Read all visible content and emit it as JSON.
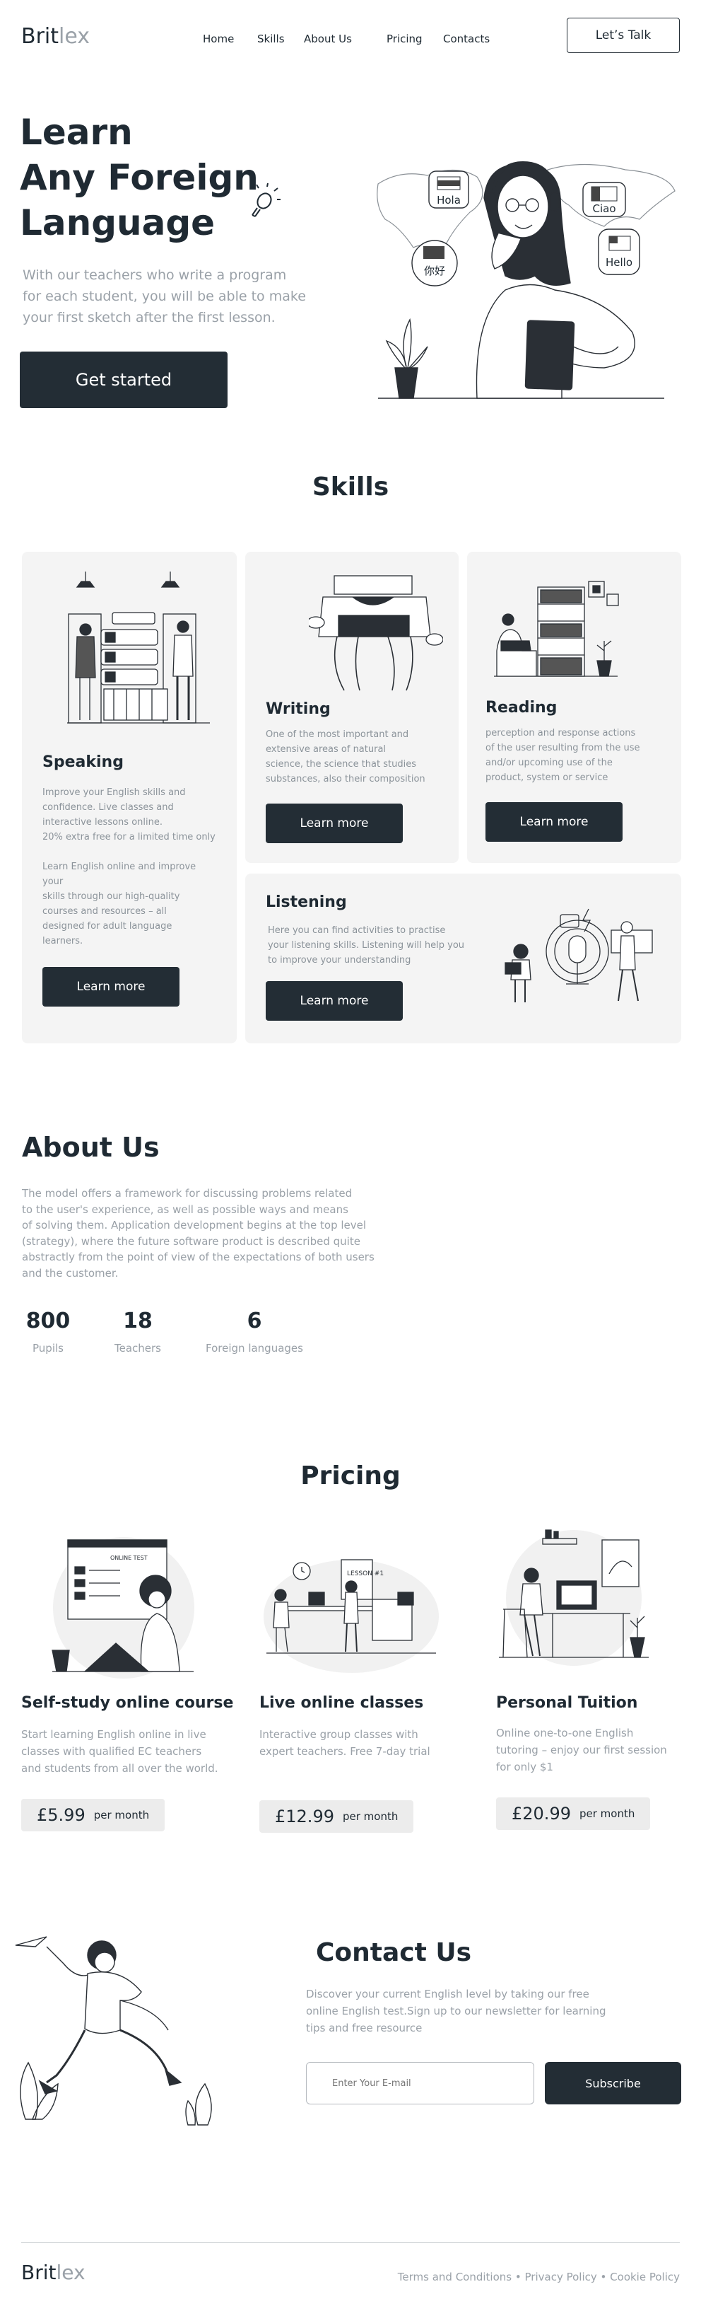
{
  "header": {
    "logo_bold": "Brit",
    "logo_light": "lex",
    "nav": [
      {
        "label": "Home"
      },
      {
        "label": "Skills"
      },
      {
        "label": "About Us"
      },
      {
        "label": "Pricing"
      },
      {
        "label": "Contacts"
      }
    ],
    "cta_label": "Let’s Talk"
  },
  "hero": {
    "title_line1": "Learn",
    "title_line2": "Any Foreign",
    "title_line3": "Language",
    "subtitle": "With our teachers who write a program\nfor each student, you will be able to make\nyour first sketch after the first lesson.",
    "button_label": "Get started",
    "bubbles": {
      "hola": "Hola",
      "ciao": "Ciao",
      "nihao": "你好",
      "hello": "Hello"
    }
  },
  "skills": {
    "title": "Skills",
    "speaking": {
      "title": "Speaking",
      "text": "Improve your English skills and\nconfidence. Live classes and\ninteractive lessons online.\n20% extra free for a limited time only\n\nLearn English online and improve\nyour\nskills through our high-quality\ncourses and resources – all\ndesigned for adult language\nlearners.",
      "button": "Learn more"
    },
    "writing": {
      "title": "Writing",
      "text": "One of the most important and\nextensive areas of natural\nscience, the science that studies\nsubstances, also their composition",
      "button": "Learn more"
    },
    "reading": {
      "title": "Reading",
      "text": "perception and response actions\nof the user resulting from the use\nand/or upcoming use of the\nproduct, system or service",
      "button": "Learn more"
    },
    "listening": {
      "title": "Listening",
      "text": "Here you can find activities to practise\nyour listening skills. Listening will help you\nto improve your understanding",
      "button": "Learn more"
    }
  },
  "about": {
    "title": "About Us",
    "text": "The model offers a framework for discussing problems related\nto the user's experience, as well as possible ways and means\nof solving them. Application development begins at the top level\n(strategy), where the future software product is described quite\nabstractly from the point of view of the expectations of both users\nand the customer.",
    "stats": [
      {
        "value": "800",
        "label": "Pupils"
      },
      {
        "value": "18",
        "label": "Teachers"
      },
      {
        "value": "6",
        "label": "Foreign languages"
      }
    ]
  },
  "pricing": {
    "title": "Pricing",
    "plans": [
      {
        "title": "Self-study online course",
        "text": "Start learning English online in live\nclasses with qualified EC teachers\nand students from all over the world.",
        "price": "£5.99",
        "per": "per month",
        "screen_label": "ONLINE TEST"
      },
      {
        "title": "Live online classes",
        "text": "Interactive group classes with\nexpert teachers. Free 7-day trial",
        "price": "£12.99",
        "per": "per month",
        "board_label": "LESSON #1"
      },
      {
        "title": "Personal Tuition",
        "text": "Online one-to-one English\ntutoring – enjoy our first session\nfor only $1",
        "price": "£20.99",
        "per": "per month"
      }
    ]
  },
  "contact": {
    "title": "Contact Us",
    "text": "Discover your current English level by taking our free\nonline English test.Sign up to our newsletter for learning\ntips and free resource",
    "email_placeholder": "Enter Your E-mail",
    "email_value": "",
    "subscribe_label": "Subscribe"
  },
  "footer": {
    "logo_bold": "Brit",
    "logo_light": "lex",
    "links": [
      {
        "label": "Terms and Conditions"
      },
      {
        "label": "Privacy Policy"
      },
      {
        "label": "Cookie Policy"
      }
    ],
    "separator": "•"
  },
  "colors": {
    "dark": "#232d35",
    "card_bg": "#f4f4f4",
    "muted_text": "#9aa1a8"
  },
  "icons": [
    "lightbulb-icon"
  ]
}
